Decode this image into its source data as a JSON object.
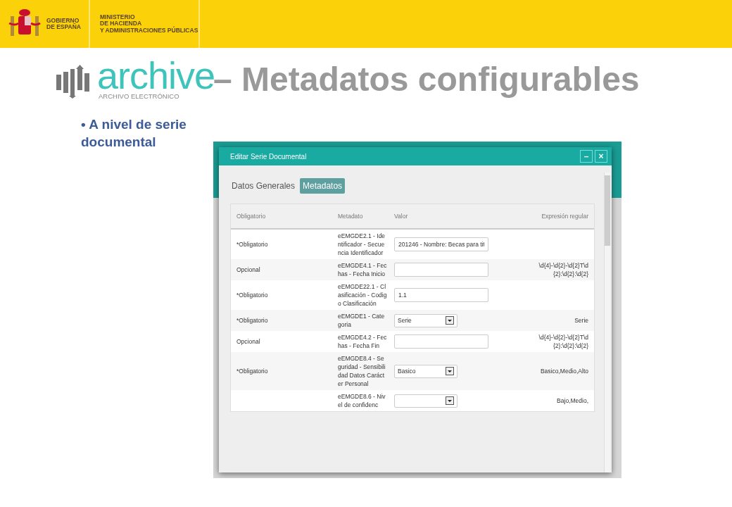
{
  "header": {
    "government": [
      "GOBIERNO",
      "DE ESPAÑA"
    ],
    "ministry": [
      "MINISTERIO",
      "DE HACIENDA",
      "Y ADMINISTRACIONES PÚBLICAS"
    ]
  },
  "logo": {
    "wordmark": "archive",
    "tagline": "ARCHIVO ELECTRÓNICO"
  },
  "slide_title": "– Metadatos configurables",
  "bullet": {
    "mark": "•",
    "text": "A nivel de serie documental"
  },
  "dialog": {
    "title": "Editar Serie Documental",
    "buttons": [
      "–",
      "×"
    ],
    "tabs": [
      {
        "label": "Datos Generales",
        "selected": false
      },
      {
        "label": "Metadatos",
        "selected": true
      }
    ],
    "columns": [
      "Obligatorio",
      "Metadato",
      "Valor",
      "Expresión regular"
    ],
    "rows": [
      {
        "requirement": "*Obligatorio",
        "metadata": "eEMGDE2.1 - Identificador - Secuencia Identificador",
        "kind": "text",
        "value": "201246 - Nombre: Becas para tit",
        "regex": ""
      },
      {
        "requirement": "Opcional",
        "metadata": "eEMGDE4.1 - Fechas - Fecha Inicio",
        "kind": "text",
        "value": "",
        "regex": "\\d{4}-\\d{2}-\\d{2}T\\d{2}:\\d{2}:\\d{2}"
      },
      {
        "requirement": "*Obligatorio",
        "metadata": "eEMGDE22.1 - Clasificación - Codigo Clasificación",
        "kind": "text",
        "value": "1.1",
        "regex": ""
      },
      {
        "requirement": "*Obligatorio",
        "metadata": "eEMGDE1 - Categoria",
        "kind": "select",
        "value": "Serie",
        "regex": "Serie"
      },
      {
        "requirement": "Opcional",
        "metadata": "eEMGDE4.2 - Fechas - Fecha Fin",
        "kind": "text",
        "value": "",
        "regex": "\\d{4}-\\d{2}-\\d{2}T\\d{2}:\\d{2}:\\d{2}"
      },
      {
        "requirement": "*Obligatorio",
        "metadata": "eEMGDE8.4 - Seguridad - Sensibilidad Datos Carácter Personal",
        "kind": "select",
        "value": "Basico",
        "regex": "Basico,Medio,Alto"
      },
      {
        "requirement": "",
        "metadata": "eEMGDE8.6 - Nivel de confidenc",
        "kind": "select",
        "value": "",
        "regex": "Bajo,Medio,"
      }
    ]
  }
}
